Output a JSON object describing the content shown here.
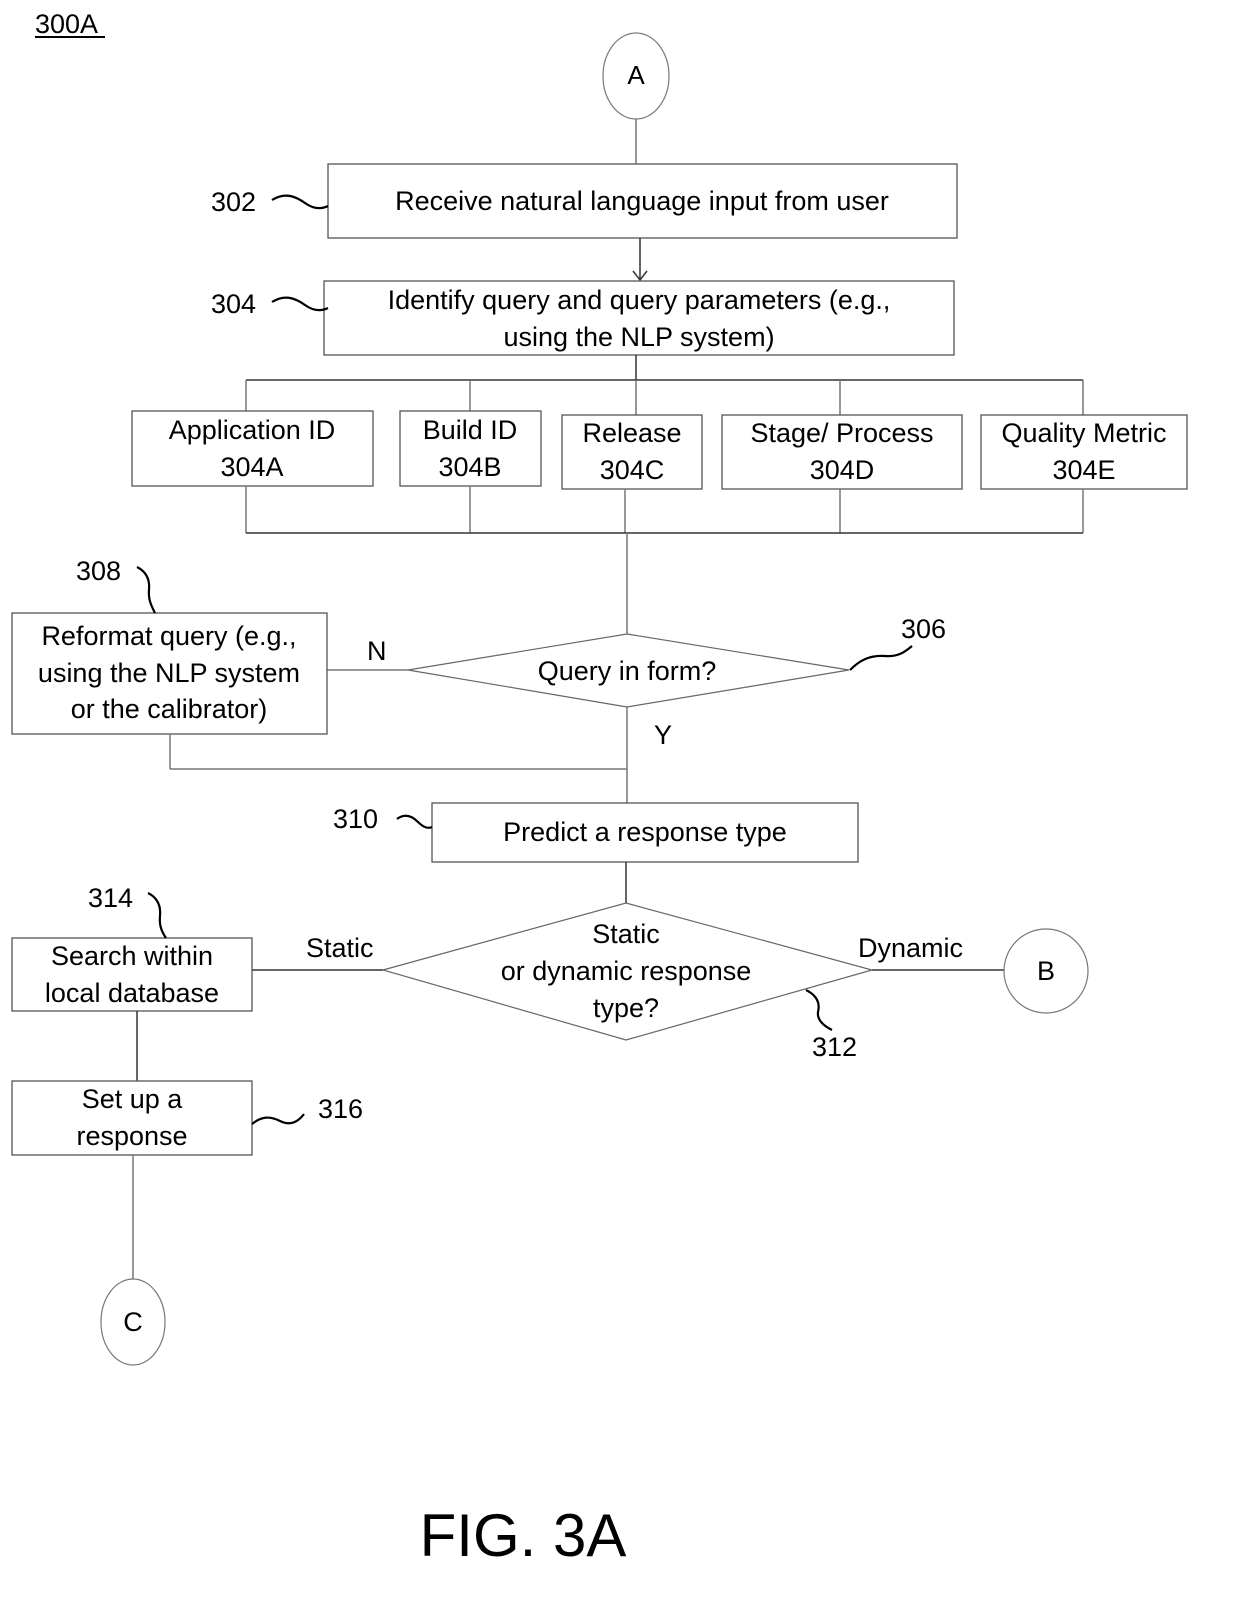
{
  "figure": {
    "id_label": "300A",
    "caption": "FIG. 3A"
  },
  "connectors": {
    "a": "A",
    "b": "B",
    "c": "C"
  },
  "steps": {
    "s302": {
      "ref": "302",
      "text": "Receive natural language input from user"
    },
    "s304": {
      "ref": "304",
      "lines": [
        "Identify query and query parameters (e.g.,",
        "using the NLP system)"
      ]
    },
    "params": [
      {
        "label": "Application ID",
        "ref": "304A"
      },
      {
        "label": "Build ID",
        "ref": "304B"
      },
      {
        "label": "Release",
        "ref": "304C"
      },
      {
        "label": "Stage/ Process",
        "ref": "304D"
      },
      {
        "label": "Quality Metric",
        "ref": "304E"
      }
    ],
    "s306": {
      "ref": "306",
      "text": "Query in form?",
      "no_label": "N",
      "yes_label": "Y"
    },
    "s308": {
      "ref": "308",
      "lines": [
        "Reformat query (e.g.,",
        "using the NLP system",
        "or the calibrator)"
      ]
    },
    "s310": {
      "ref": "310",
      "text": "Predict a response type"
    },
    "s312": {
      "ref": "312",
      "lines": [
        "Static",
        "or dynamic response",
        "type?"
      ],
      "static_label": "Static",
      "dynamic_label": "Dynamic"
    },
    "s314": {
      "ref": "314",
      "lines": [
        "Search within",
        "local database"
      ]
    },
    "s316": {
      "ref": "316",
      "lines": [
        "Set up a",
        "response"
      ]
    }
  }
}
